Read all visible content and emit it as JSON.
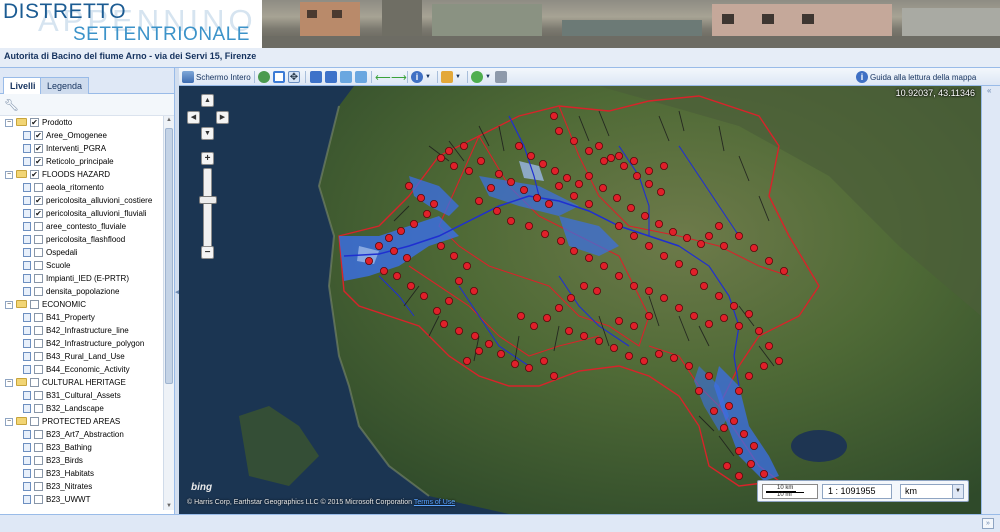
{
  "header": {
    "logo_line1": "DISTRETTO",
    "logo_line2": "SETTENTRIONALE",
    "logo_watermark": "APPENNINO",
    "authority": "Autorita di Bacino del fiume Arno - via dei Servi 15, Firenze"
  },
  "tabs": [
    {
      "label": "Livelli",
      "active": true
    },
    {
      "label": "Legenda",
      "active": false
    }
  ],
  "tree": [
    {
      "label": "Prodotto",
      "type": "folder",
      "level": 0,
      "checked": true
    },
    {
      "label": "Aree_Omogenee",
      "type": "layer",
      "level": 1,
      "checked": true
    },
    {
      "label": "Interventi_PGRA",
      "type": "layer",
      "level": 1,
      "checked": true
    },
    {
      "label": "Reticolo_principale",
      "type": "layer",
      "level": 1,
      "checked": true
    },
    {
      "label": "FLOODS HAZARD",
      "type": "folder",
      "level": 0,
      "checked": true
    },
    {
      "label": "aeola_ritornento",
      "type": "layer",
      "level": 1,
      "checked": false
    },
    {
      "label": "pericolosita_alluvioni_costiere",
      "type": "layer",
      "level": 1,
      "checked": true
    },
    {
      "label": "pericolosita_alluvioni_fluviali",
      "type": "layer",
      "level": 1,
      "checked": true
    },
    {
      "label": "aree_contesto_fluviale",
      "type": "layer",
      "level": 1,
      "checked": false
    },
    {
      "label": "pericolosita_flashflood",
      "type": "layer",
      "level": 1,
      "checked": false
    },
    {
      "label": "Ospedali",
      "type": "layer",
      "level": 1,
      "checked": false
    },
    {
      "label": "Scuole",
      "type": "layer",
      "level": 1,
      "checked": false
    },
    {
      "label": "Impianti_IED (E-PRTR)",
      "type": "layer",
      "level": 1,
      "checked": false
    },
    {
      "label": "densita_popolazione",
      "type": "layer",
      "level": 1,
      "checked": false
    },
    {
      "label": "ECONOMIC",
      "type": "folder",
      "level": 0,
      "checked": false
    },
    {
      "label": "B41_Property",
      "type": "layer",
      "level": 1,
      "checked": false
    },
    {
      "label": "B42_Infrastructure_line",
      "type": "layer",
      "level": 1,
      "checked": false
    },
    {
      "label": "B42_Infrastructure_polygon",
      "type": "layer",
      "level": 1,
      "checked": false
    },
    {
      "label": "B43_Rural_Land_Use",
      "type": "layer",
      "level": 1,
      "checked": false
    },
    {
      "label": "B44_Economic_Activity",
      "type": "layer",
      "level": 1,
      "checked": false
    },
    {
      "label": "CULTURAL HERITAGE",
      "type": "folder",
      "level": 0,
      "checked": false
    },
    {
      "label": "B31_Cultural_Assets",
      "type": "layer",
      "level": 1,
      "checked": false
    },
    {
      "label": "B32_Landscape",
      "type": "layer",
      "level": 1,
      "checked": false
    },
    {
      "label": "PROTECTED AREAS",
      "type": "folder",
      "level": 0,
      "checked": false
    },
    {
      "label": "B23_Art7_Abstraction",
      "type": "layer",
      "level": 1,
      "checked": false
    },
    {
      "label": "B23_Bathing",
      "type": "layer",
      "level": 1,
      "checked": false
    },
    {
      "label": "B23_Birds",
      "type": "layer",
      "level": 1,
      "checked": false
    },
    {
      "label": "B23_Habitats",
      "type": "layer",
      "level": 1,
      "checked": false
    },
    {
      "label": "B23_Nitrates",
      "type": "layer",
      "level": 1,
      "checked": false
    },
    {
      "label": "B23_UWWT",
      "type": "layer",
      "level": 1,
      "checked": false
    }
  ],
  "toolbar": {
    "fullscreen": "Schermo Intero",
    "guide": "Guida alla lettura della mappa"
  },
  "map": {
    "coords": "10.92037, 43.11346",
    "attribution": "© Harris Corp, Earthstar Geographics LLC © 2015 Microsoft Corporation",
    "terms": "Terms of Use",
    "bing": "bing",
    "scale_top": "10 km",
    "scale_bottom": "10 mi",
    "scale_value": "1 : 1091955",
    "unit": "km"
  },
  "colors": {
    "boundary": "#d8232a",
    "intervention": "#e0202a",
    "hazard": "#3b6fe8",
    "river": "#1f2fd0"
  }
}
